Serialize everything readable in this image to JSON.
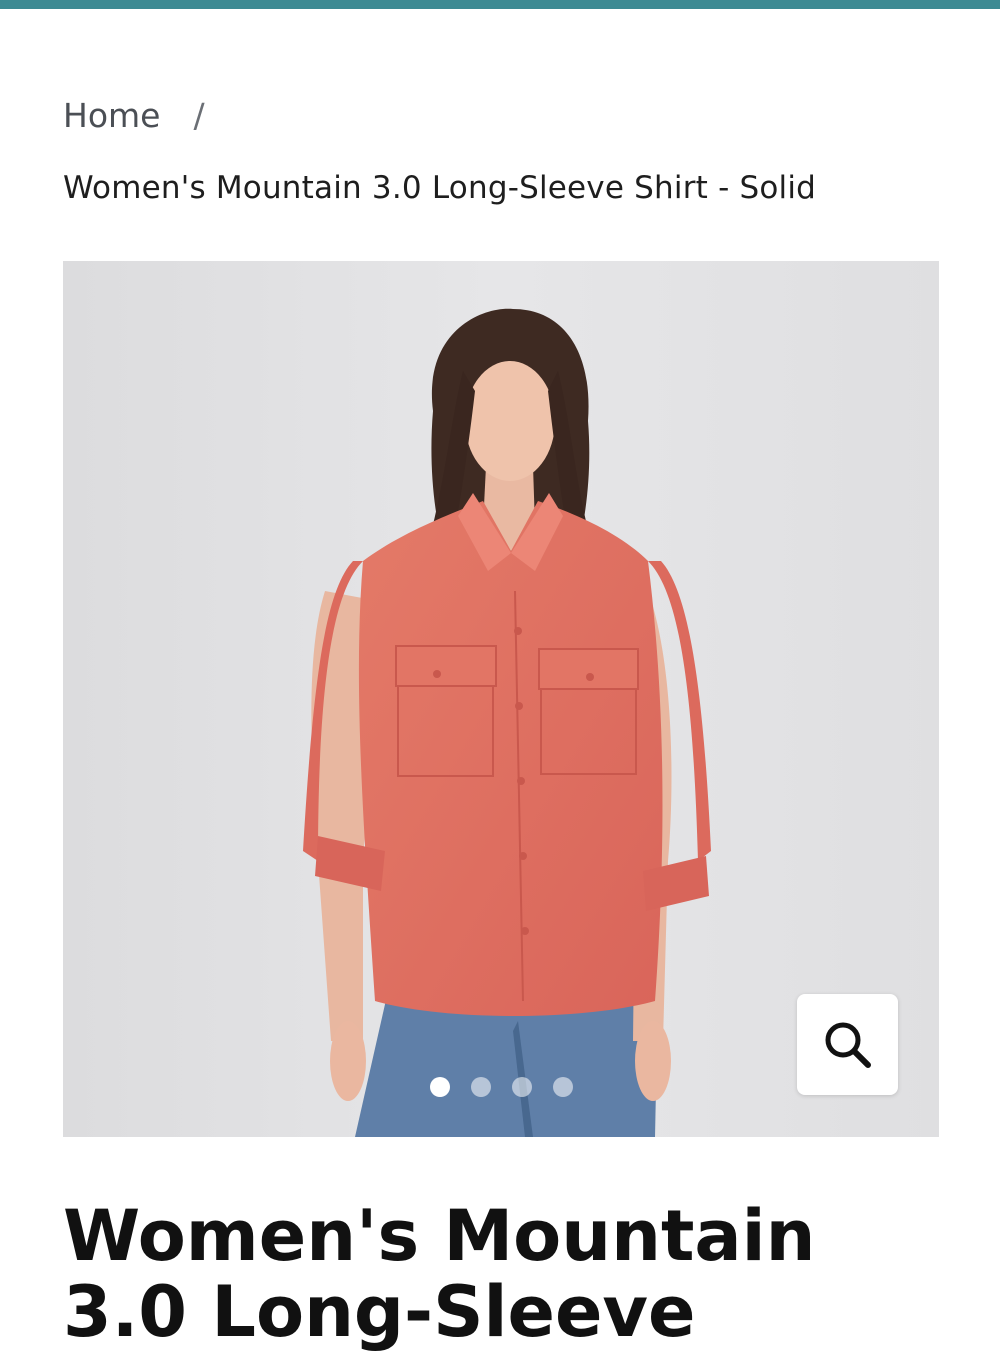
{
  "theme": {
    "accent_bar_color": "#3d8a93",
    "shirt_color": "#e2705f",
    "background_color": "#e3e3e5"
  },
  "breadcrumb": {
    "home_label": "Home",
    "separator": "/",
    "current_label": "Women's Mountain 3.0 Long-Sleeve Shirt - Solid"
  },
  "gallery": {
    "image_description_icon": "product-photo",
    "zoom_icon": "search-icon",
    "slide_count": 4,
    "active_slide": 1
  },
  "product": {
    "title": "Women's Mountain 3.0 Long-Sleeve"
  }
}
